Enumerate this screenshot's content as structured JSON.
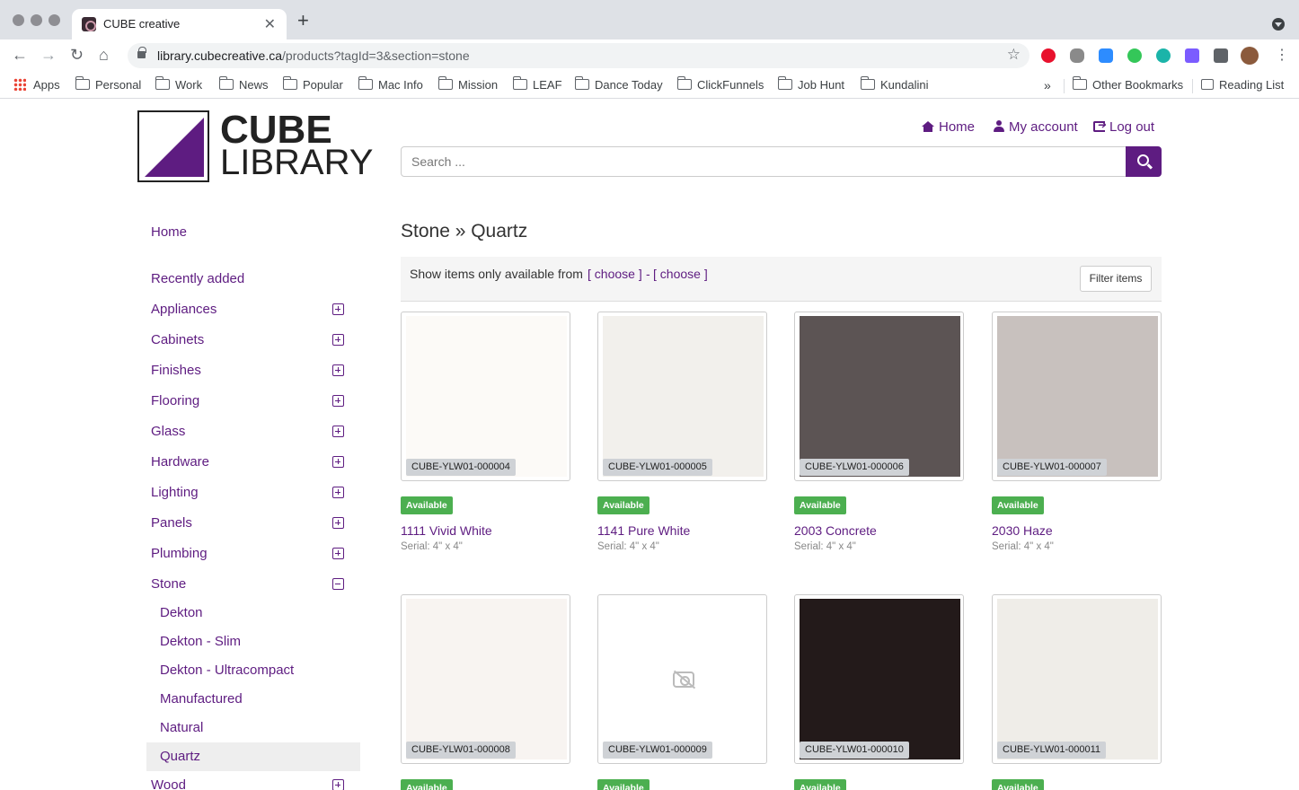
{
  "browser": {
    "tab_title": "CUBE creative",
    "url_host": "library.cubecreative.ca",
    "url_path": "/products?tagId=3&section=stone",
    "bookmarks": [
      "Apps",
      "Personal",
      "Work",
      "News",
      "Popular",
      "Mac Info",
      "Mission",
      "LEAF",
      "Dance Today",
      "ClickFunnels",
      "Job Hunt",
      "Kundalini"
    ],
    "overflow": "»",
    "other_bookmarks": "Other Bookmarks",
    "reading_list": "Reading List"
  },
  "header": {
    "logo_line1": "CUBE",
    "logo_line2": "LIBRARY",
    "home": "Home",
    "my_account": "My account",
    "log_out": "Log out",
    "search_placeholder": "Search ..."
  },
  "sidebar": {
    "home": "Home",
    "recently_added": "Recently added",
    "categories": [
      "Appliances",
      "Cabinets",
      "Finishes",
      "Flooring",
      "Glass",
      "Hardware",
      "Lighting",
      "Panels",
      "Plumbing",
      "Stone"
    ],
    "stone_sub": [
      "Dekton",
      "Dekton - Slim",
      "Dekton - Ultracompact",
      "Manufactured",
      "Natural",
      "Quartz"
    ],
    "wood": "Wood"
  },
  "main": {
    "heading": "Stone » Quartz",
    "filter_label": "Show items only available from",
    "choose_from": "[ choose ]",
    "dash": "-",
    "choose_to": "[ choose ]",
    "filter_button": "Filter items"
  },
  "products": [
    {
      "code": "CUBE-YLW01-000004",
      "status": "Available",
      "name": "1111 Vivid White",
      "serial": "Serial: 4\" x 4\"",
      "color": "#fcfaf7"
    },
    {
      "code": "CUBE-YLW01-000005",
      "status": "Available",
      "name": "1141 Pure White",
      "serial": "Serial: 4\" x 4\"",
      "color": "#f2f0ec"
    },
    {
      "code": "CUBE-YLW01-000006",
      "status": "Available",
      "name": "2003 Concrete",
      "serial": "Serial: 4\" x 4\"",
      "color": "#5c5454"
    },
    {
      "code": "CUBE-YLW01-000007",
      "status": "Available",
      "name": "2030 Haze",
      "serial": "Serial: 4\" x 4\"",
      "color": "#c8c1be"
    },
    {
      "code": "CUBE-YLW01-000008",
      "status": "Available",
      "color": "#f8f4f1"
    },
    {
      "code": "CUBE-YLW01-000009",
      "status": "Available",
      "color": "#ffffff",
      "no_image": true
    },
    {
      "code": "CUBE-YLW01-000010",
      "status": "Available",
      "color": "#231a1a"
    },
    {
      "code": "CUBE-YLW01-000011",
      "status": "Available",
      "color": "#efede8"
    }
  ],
  "colors": {
    "brand": "#5e1c81",
    "available": "#4caf50"
  }
}
